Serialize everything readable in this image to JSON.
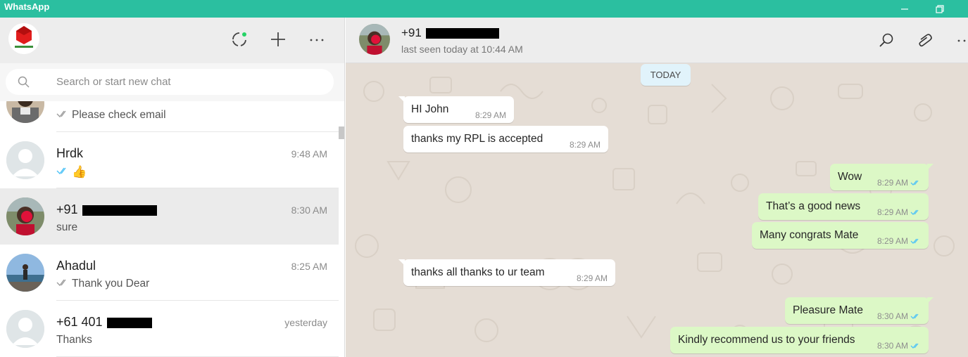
{
  "app": {
    "title": "WhatsApp"
  },
  "colors": {
    "accent": "#2bbfa0",
    "outgoing_bubble": "#dcf8c6",
    "incoming_bubble": "#ffffff",
    "chat_background": "#e5ddd5",
    "read_ticks": "#4fc3f7"
  },
  "left_header": {
    "icons": [
      "status-icon",
      "new-chat-icon",
      "menu-icon"
    ]
  },
  "search": {
    "placeholder": "Search or start new chat",
    "value": ""
  },
  "chats": [
    {
      "name": "",
      "time": "",
      "preview": "Please check email",
      "ticks": "double-grey"
    },
    {
      "name": "Hrdk",
      "time": "9:48 AM",
      "preview": "👍",
      "ticks": "double-blue"
    },
    {
      "name": "+91",
      "time": "8:30 AM",
      "preview": "sure",
      "ticks": "none",
      "active": true
    },
    {
      "name": "Ahadul",
      "time": "8:25 AM",
      "preview": "Thank you Dear",
      "ticks": "double-grey"
    },
    {
      "name": "+61 401",
      "time": "yesterday",
      "preview": "Thanks",
      "ticks": "none"
    }
  ],
  "conversation": {
    "contact_name": "+91",
    "status": "last seen today at 10:44 AM",
    "day_label": "TODAY",
    "messages": [
      {
        "direction": "in",
        "text": "HI John",
        "time": "8:29 AM"
      },
      {
        "direction": "in",
        "text": "thanks my RPL is accepted",
        "time": "8:29 AM"
      },
      {
        "direction": "out",
        "text": "Wow",
        "time": "8:29 AM"
      },
      {
        "direction": "out",
        "text": "That’s a good news",
        "time": "8:29 AM"
      },
      {
        "direction": "out",
        "text": "Many congrats Mate",
        "time": "8:29 AM"
      },
      {
        "direction": "in",
        "text": "thanks all thanks to ur team",
        "time": "8:29 AM"
      },
      {
        "direction": "out",
        "text": "Pleasure Mate",
        "time": "8:30 AM"
      },
      {
        "direction": "out",
        "text": "Kindly recommend us to your friends",
        "time": "8:30 AM"
      }
    ]
  }
}
